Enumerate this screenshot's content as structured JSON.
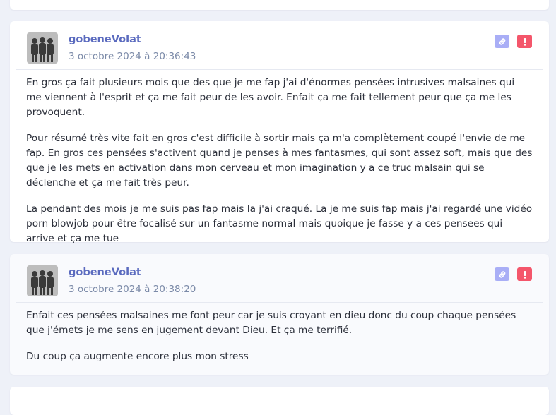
{
  "posts": [
    {
      "author": "gobeneVolat",
      "date": "3 octobre 2024 à 20:36:43",
      "paragraphs": [
        "En gros ça fait plusieurs mois que des que je me fap j'ai d'énormes pensées intrusives malsaines qui me viennent à l'esprit et ça me fait peur de les avoir. Enfait ça me fait tellement peur que ça me les provoquent.",
        "Pour résumé très vite fait en gros c'est difficile à sortir mais ça m'a complètement coupé l'envie de me fap. En gros ces pensées s'activent quand je penses à mes fantasmes, qui sont assez soft, mais que des que je les mets en activation dans mon cerveau et mon imagination y a ce truc malsain qui se déclenche et ça me fait très peur.",
        "La pendant des mois je me suis pas fap mais la j'ai craqué. La je me suis fap mais j'ai regardé une vidéo porn blowjob pour être focalisé sur un fantasme normal mais quoique je fasse y a ces pensees qui arrive et ça me tue"
      ]
    },
    {
      "author": "gobeneVolat",
      "date": "3 octobre 2024 à 20:38:20",
      "paragraphs": [
        "Enfait ces pensées malsaines me font peur car je suis croyant en dieu donc du coup chaque pensées que j'émets je me sens en jugement devant Dieu. Et ça me terrifié.",
        "Du coup ça augmente encore plus mon stress"
      ]
    }
  ],
  "icons": {
    "link": "link-icon",
    "alert": "exclamation-icon"
  },
  "colors": {
    "background": "#eef1f8",
    "author": "#5b6bbf",
    "date": "#7b8aa8",
    "link_button": "#a9aef6",
    "alert_button": "#f4566b"
  }
}
